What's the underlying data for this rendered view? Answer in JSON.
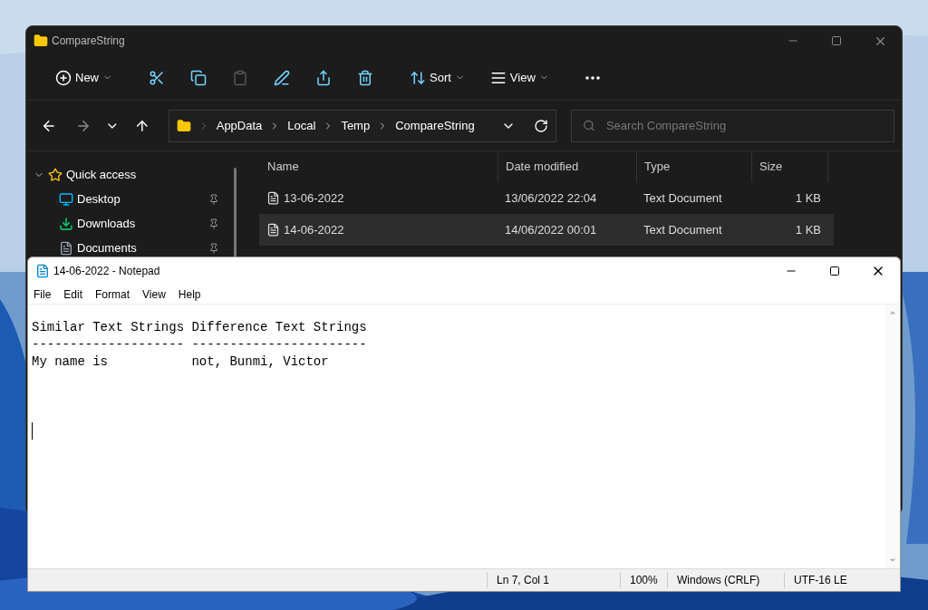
{
  "explorer": {
    "title": "CompareString",
    "toolbar": [
      {
        "kind": "new",
        "label": "New",
        "disabled": false
      },
      {
        "kind": "cut",
        "disabled": false
      },
      {
        "kind": "copy",
        "disabled": false
      },
      {
        "kind": "paste",
        "disabled": true
      },
      {
        "kind": "rename",
        "disabled": false
      },
      {
        "kind": "share",
        "disabled": false
      },
      {
        "kind": "delete",
        "disabled": false
      },
      {
        "kind": "sort",
        "label": "Sort",
        "disabled": false
      },
      {
        "kind": "view",
        "label": "View",
        "disabled": false
      },
      {
        "kind": "more",
        "disabled": false
      }
    ],
    "address": [
      "AppData",
      "Local",
      "Temp",
      "CompareString"
    ],
    "search": {
      "placeholder": "Search CompareString"
    },
    "sidebar": [
      {
        "kind": "star",
        "label": "Quick access",
        "expanded": true,
        "pinned": false
      },
      {
        "kind": "desktop",
        "label": "Desktop",
        "pinned": true
      },
      {
        "kind": "downloads",
        "label": "Downloads",
        "pinned": true
      },
      {
        "kind": "documents",
        "label": "Documents",
        "pinned": true
      }
    ],
    "columns": [
      "Name",
      "Date modified",
      "Type",
      "Size"
    ],
    "rows": [
      {
        "name": "13-06-2022",
        "date": "13/06/2022 22:04",
        "type": "Text Document",
        "size": "1 KB",
        "selected": false
      },
      {
        "name": "14-06-2022",
        "date": "14/06/2022 00:01",
        "type": "Text Document",
        "size": "1 KB",
        "selected": true
      }
    ]
  },
  "notepad": {
    "title": "14-06-2022 - Notepad",
    "menu": [
      "File",
      "Edit",
      "Format",
      "View",
      "Help"
    ],
    "lines": [
      "Similar Text Strings Difference Text Strings",
      "-------------------- -----------------------",
      "My name is           not, Bunmi, Victor"
    ],
    "status": [
      "Ln 7, Col 1",
      "100%",
      "Windows (CRLF)",
      "UTF-16 LE"
    ]
  }
}
